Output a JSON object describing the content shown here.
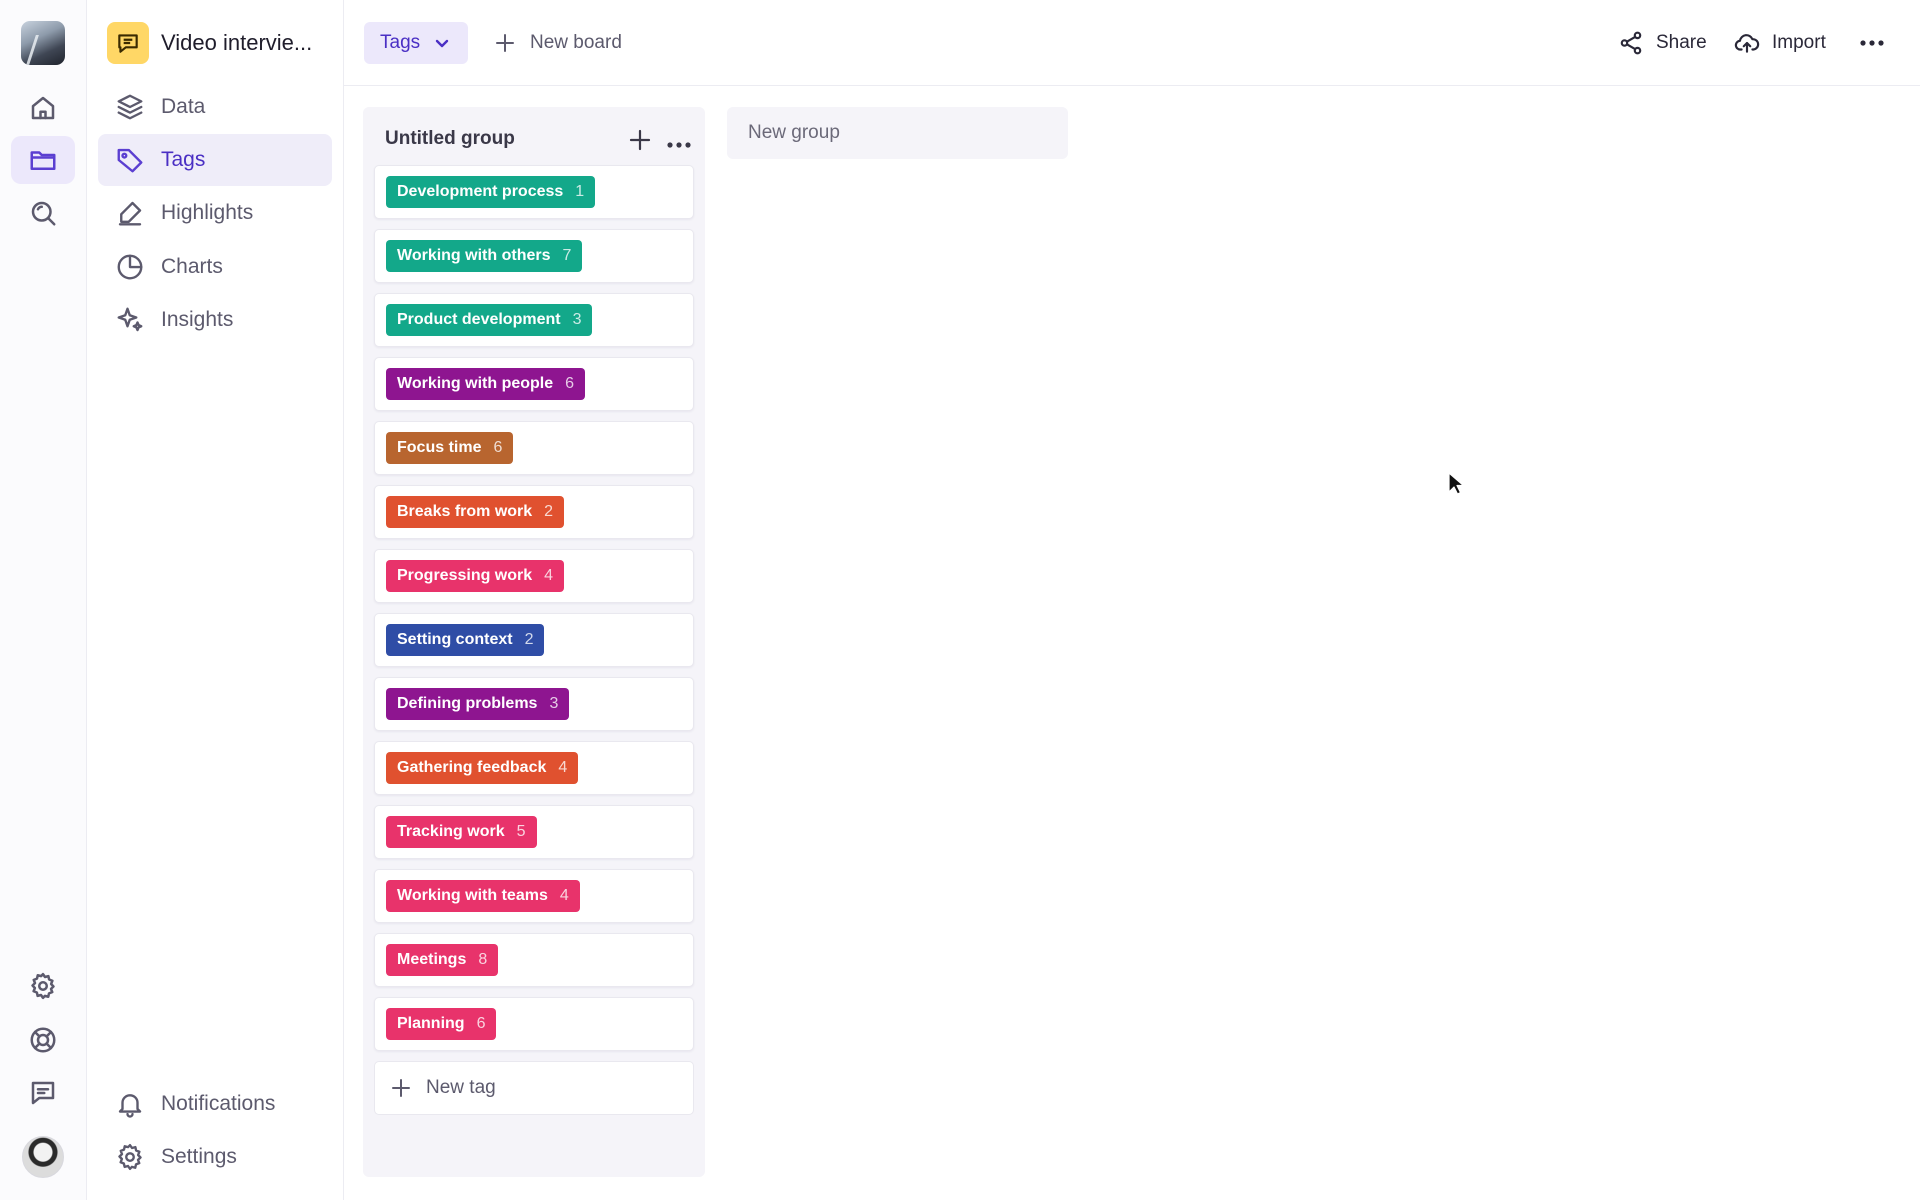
{
  "project": {
    "title": "Video intervie..."
  },
  "sidebar": {
    "items": [
      {
        "label": "Data",
        "icon": "layers-icon"
      },
      {
        "label": "Tags",
        "icon": "tag-icon",
        "active": true
      },
      {
        "label": "Highlights",
        "icon": "highlighter-icon"
      },
      {
        "label": "Charts",
        "icon": "pie-chart-icon"
      },
      {
        "label": "Insights",
        "icon": "sparkles-icon"
      }
    ],
    "bottom": [
      {
        "label": "Notifications",
        "icon": "bell-icon"
      },
      {
        "label": "Settings",
        "icon": "gear-icon"
      }
    ]
  },
  "topbar": {
    "view_label": "Tags",
    "new_board_label": "New board",
    "share_label": "Share",
    "import_label": "Import"
  },
  "board": {
    "group_title": "Untitled group",
    "new_group_label": "New group",
    "new_tag_label": "New tag",
    "tags": [
      {
        "label": "Development process",
        "count": "1",
        "color": "#13a88a"
      },
      {
        "label": "Working with others",
        "count": "7",
        "color": "#13a88a"
      },
      {
        "label": "Product development",
        "count": "3",
        "color": "#13a88a"
      },
      {
        "label": "Working with people",
        "count": "6",
        "color": "#8e1590"
      },
      {
        "label": "Focus time",
        "count": "6",
        "color": "#b8652f"
      },
      {
        "label": "Breaks from work",
        "count": "2",
        "color": "#e0512f"
      },
      {
        "label": "Progressing work",
        "count": "4",
        "color": "#e8336b"
      },
      {
        "label": "Setting context",
        "count": "2",
        "color": "#2f4da6"
      },
      {
        "label": "Defining problems",
        "count": "3",
        "color": "#8e1590"
      },
      {
        "label": "Gathering feedback",
        "count": "4",
        "color": "#e0512f"
      },
      {
        "label": "Tracking work",
        "count": "5",
        "color": "#e8336b"
      },
      {
        "label": "Working with teams",
        "count": "4",
        "color": "#e8336b"
      },
      {
        "label": "Meetings",
        "count": "8",
        "color": "#e8336b"
      },
      {
        "label": "Planning",
        "count": "6",
        "color": "#e8336b"
      }
    ]
  },
  "colors": {
    "accent": "#5b3fd1",
    "accent_bg": "#ece8fb"
  }
}
